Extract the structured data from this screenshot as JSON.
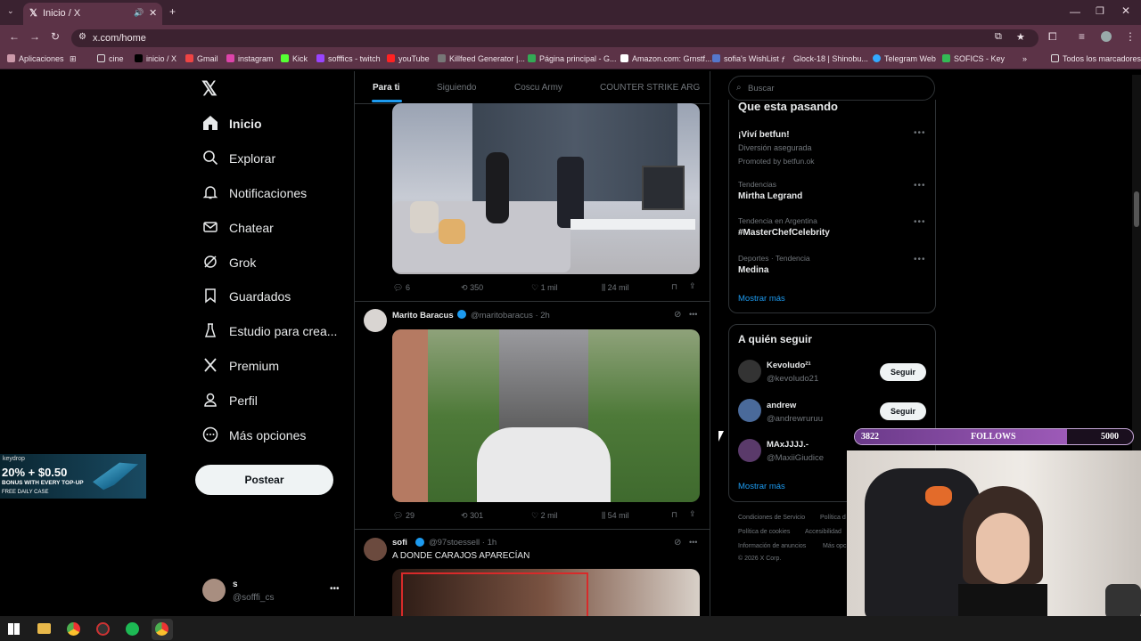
{
  "browser": {
    "tab_title": "Inicio / X",
    "url": "x.com/home",
    "bookmarks": [
      "Aplicaciones",
      "cine",
      "inicio / X",
      "Gmail",
      "instagram",
      "Kick",
      "sofffics - twitch",
      "youTube",
      "Killfeed Generator |...",
      "Página principal - G...",
      "Amazon.com: Grnstf...",
      "sofia's WishList",
      "Glock-18 | Shinobu...",
      "Telegram Web",
      "SOFICS - Key",
      "Todos los marcadores"
    ]
  },
  "nav": {
    "items": [
      "Inicio",
      "Explorar",
      "Notificaciones",
      "Chatear",
      "Grok",
      "Guardados",
      "Estudio para crea...",
      "Premium",
      "Perfil",
      "Más opciones"
    ],
    "post_label": "Postear",
    "user_name": "s",
    "user_handle": "@sofffi_cs"
  },
  "feed": {
    "tabs": [
      "Para ti",
      "Siguiendo",
      "Coscu Army",
      "COUNTER STRIKE ARG"
    ],
    "post1": {
      "replies": "6",
      "reposts": "350",
      "likes": "1 mil",
      "views": "24 mil"
    },
    "post2": {
      "author": "Marito Baracus",
      "handle": "@maritobaracus · 2h",
      "replies": "29",
      "reposts": "301",
      "likes": "2 mil",
      "views": "54 mil"
    },
    "post3": {
      "author": "sofi",
      "handle": "@97stoessell · 1h",
      "text": "A DONDE CARAJOS APARECÍAN"
    }
  },
  "search": {
    "placeholder": "Buscar"
  },
  "trends": {
    "title": "Que esta pasando",
    "promo": {
      "name": "¡Viví betfun!",
      "desc": "Diversión asegurada",
      "by": "Promoted by betfun.ok"
    },
    "items": [
      {
        "ctx": "Tendencias",
        "name": "Mirtha Legrand"
      },
      {
        "ctx": "Tendencia en Argentina",
        "name": "#MasterChefCelebrity"
      },
      {
        "ctx": "Deportes · Tendencia",
        "name": "Medina"
      }
    ],
    "more": "Mostrar más"
  },
  "follow": {
    "title": "A quién seguir",
    "users": [
      {
        "name": "Kevoludo²¹",
        "handle": "@kevoludo21"
      },
      {
        "name": "andrew",
        "handle": "@andrewruruu"
      },
      {
        "name": "MAxJJJJ.-",
        "handle": "@MaxiiGiudice"
      }
    ],
    "button": "Seguir",
    "more": "Mostrar más"
  },
  "footer": [
    "Condiciones de Servicio",
    "Política d",
    "Política de cookies",
    "Accesibilidad",
    "Información de anuncios",
    "Más opc",
    "© 2026 X Corp."
  ],
  "overlay": {
    "follows_current": "3822",
    "follows_label": "FOLLOWS",
    "follows_goal": "5000",
    "follows_progress": 0.7644,
    "ad_brand": "keydrop",
    "ad_line1": "20% + $0.50",
    "ad_line2": "BONUS WITH EVERY TOP-UP",
    "ad_line3": "FREE DAILY CASE"
  },
  "colors": {
    "accent": "#1d9bf0",
    "chrome": "#5c3347"
  }
}
